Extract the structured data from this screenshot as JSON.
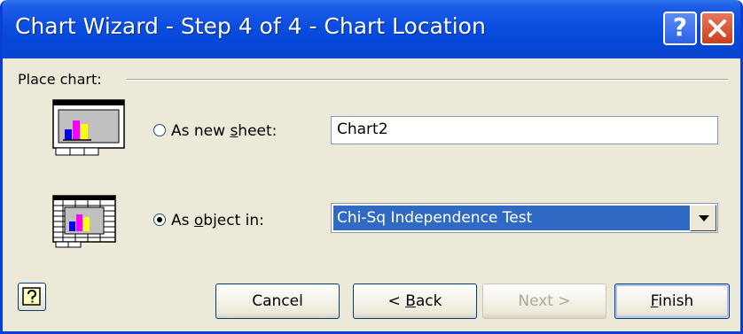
{
  "window": {
    "title": "Chart Wizard - Step 4 of 4 - Chart Location",
    "help_icon": "question-icon",
    "close_icon": "close-icon"
  },
  "place_chart": {
    "label": "Place chart:",
    "new_sheet": {
      "label_prefix": "As new ",
      "label_accel": "s",
      "label_suffix": "heet:",
      "value": "Chart2",
      "selected": false,
      "icon": "chart-sheet-icon"
    },
    "as_object": {
      "label_prefix": "As ",
      "label_accel": "o",
      "label_suffix": "bject in:",
      "value": "Chi-Sq Independence Test",
      "selected": true,
      "icon": "chart-object-icon"
    }
  },
  "buttons": {
    "help_icon": "help-icon",
    "cancel": "Cancel",
    "back_prefix": "< ",
    "back_accel": "B",
    "back_suffix": "ack",
    "next": "Next >",
    "finish_accel": "F",
    "finish_suffix": "inish"
  },
  "colors": {
    "titlebar": "#0a4ee0",
    "dialog_bg": "#ece9d8",
    "selection": "#316ac5",
    "bar_blue": "#0000ff",
    "bar_magenta": "#ff00ff",
    "bar_yellow": "#ffff00"
  }
}
